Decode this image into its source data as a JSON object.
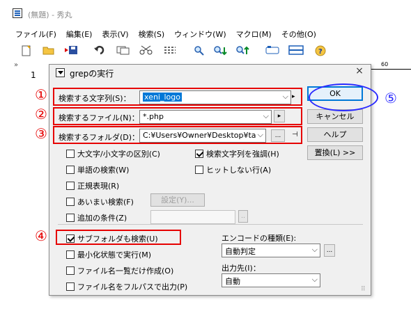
{
  "app": {
    "title": "(無題) - 秀丸",
    "menu": [
      "ファイル(F)",
      "編集(E)",
      "表示(V)",
      "検索(S)",
      "ウィンドウ(W)",
      "マクロ(M)",
      "その他(O)"
    ],
    "gutter_mark": "»",
    "line_number": "1",
    "ruler_label": "60"
  },
  "toolbar_icons": [
    "new-file-icon",
    "open-folder-icon",
    "save-icon",
    "undo-icon",
    "copy-icon",
    "cut-icon",
    "paste-icon",
    "find-icon",
    "find-prev-icon",
    "find-next-icon",
    "view-icon",
    "split-icon",
    "help-icon"
  ],
  "dialog": {
    "title": "grepの実行",
    "close_glyph": "×",
    "search_text_label": "検索する文字列(S)：",
    "search_text_value": "xeni_logo",
    "search_file_label": "検索するファイル(N)：",
    "search_file_value": "*.php",
    "search_folder_label": "検索するフォルダ(D)：",
    "search_folder_value": "C:¥Users¥Owner¥Desktop¥tabil",
    "browse_label": "...",
    "ok_label": "OK",
    "cancel_label": "キャンセル",
    "help_label": "ヘルプ",
    "replace_label": "置換(L) >>",
    "options": {
      "case": "大文字/小文字の区別(C)",
      "word": "単語の検索(W)",
      "regex": "正規表現(R)",
      "fuzzy": "あいまい検索(F)",
      "extra": "追加の条件(Z)",
      "highlight": "検索文字列を強調(H)",
      "nohit": "ヒットしない行(A)",
      "subfolder": "サブフォルダも検索(U)",
      "minimize": "最小化状態で実行(M)",
      "filelist": "ファイル名一覧だけ作成(O)",
      "fullpath": "ファイル名をフルパスで出力(P)"
    },
    "settings_label": "設定(Y)...",
    "encoding_label": "エンコードの種類(E):",
    "encoding_value": "自動判定",
    "output_label": "出力先(I)：",
    "output_value": "自動"
  },
  "annotations": {
    "n1": "①",
    "n2": "②",
    "n3": "③",
    "n4": "④",
    "n5": "⑤",
    "red": "#e60000",
    "blue": "#2a2aff"
  }
}
